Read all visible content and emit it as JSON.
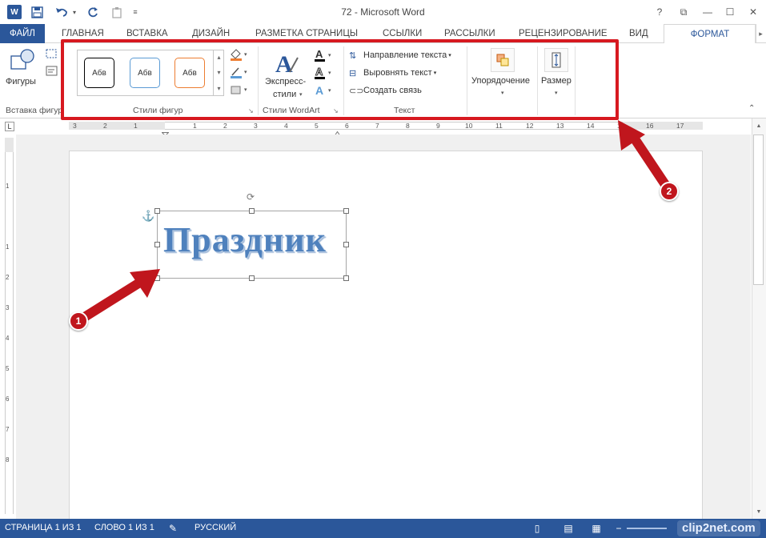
{
  "app": {
    "title": "72 - Microsoft Word",
    "logo_text": "W"
  },
  "quick_access": {
    "save_icon": "save-icon",
    "undo_icon": "undo-icon",
    "redo_icon": "redo-icon",
    "paste_icon": "paste-icon",
    "customize_icon": "customize-icon"
  },
  "window_controls": {
    "help": "?",
    "restore_ribbon": "⧉",
    "minimize": "—",
    "maximize": "☐",
    "close": "✕"
  },
  "tabs": [
    {
      "label": "ФАЙЛ"
    },
    {
      "label": "ГЛАВНАЯ"
    },
    {
      "label": "ВСТАВКА"
    },
    {
      "label": "ДИЗАЙН"
    },
    {
      "label": "РАЗМЕТКА СТРАНИЦЫ"
    },
    {
      "label": "ССЫЛКИ"
    },
    {
      "label": "РАССЫЛКИ"
    },
    {
      "label": "РЕЦЕНЗИРОВАНИЕ"
    },
    {
      "label": "ВИД"
    },
    {
      "label": "ФОРМАТ"
    }
  ],
  "ribbon": {
    "insert_shapes": {
      "shapes_label": "Фигуры",
      "group_label": "Вставка фигур"
    },
    "shape_styles": {
      "swatches": [
        {
          "label": "Абв",
          "border_color": "#000000"
        },
        {
          "label": "Абв",
          "border_color": "#5b9bd5"
        },
        {
          "label": "Абв",
          "border_color": "#ed7d31"
        }
      ],
      "group_label": "Стили фигур"
    },
    "wordart_styles": {
      "express_label_1": "Экспресс-",
      "express_label_2": "стили",
      "group_label": "Стили WordArt"
    },
    "text": {
      "direction_label": "Направление текста",
      "align_label": "Выровнять текст",
      "link_label": "Создать связь",
      "group_label": "Текст"
    },
    "arrange": {
      "label": "Упорядочение"
    },
    "size": {
      "label": "Размер"
    }
  },
  "ruler": {
    "corner": "L",
    "marks": [
      "3",
      "2",
      "1",
      "1",
      "2",
      "3",
      "4",
      "5",
      "6",
      "7",
      "8",
      "9",
      "10",
      "11",
      "12",
      "13",
      "14",
      "15",
      "16",
      "17"
    ],
    "vmarks": [
      "1",
      "1",
      "2",
      "3",
      "4",
      "5",
      "6",
      "7",
      "8"
    ]
  },
  "document": {
    "wordart_text": "Праздник"
  },
  "annotations": {
    "badge_1": "1",
    "badge_2": "2"
  },
  "status": {
    "page": "СТРАНИЦА 1 ИЗ 1",
    "words": "СЛОВО 1 ИЗ 1",
    "language": "РУССКИЙ"
  },
  "watermark": "clip2net.com",
  "colors": {
    "accent": "#2b579a",
    "highlight": "#d71920",
    "wordart": "#4f81bd"
  }
}
